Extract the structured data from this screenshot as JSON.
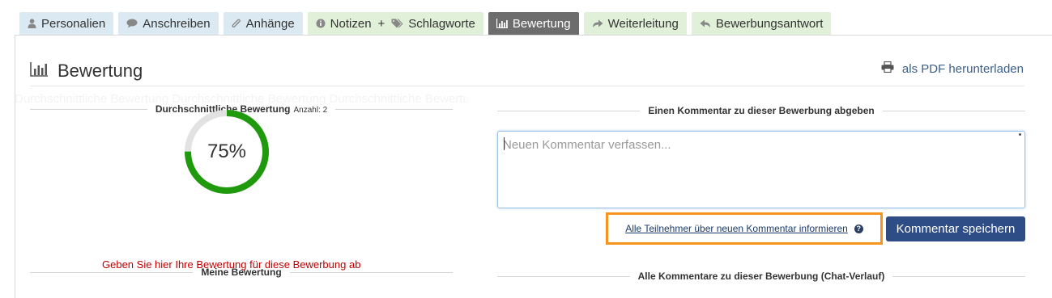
{
  "tabs": [
    {
      "label": "Personalien",
      "icon": "user-icon"
    },
    {
      "label": "Anschreiben",
      "icon": "speech-bubble-icon"
    },
    {
      "label": "Anhänge",
      "icon": "paperclip-icon"
    },
    {
      "label_a": "Notizen",
      "label_plus": "+",
      "label_b": "Schlagworte",
      "icon": "info-icon",
      "icon2": "tags-icon"
    },
    {
      "label": "Bewertung",
      "icon": "bar-chart-icon"
    },
    {
      "label": "Weiterleitung",
      "icon": "forward-arrow-icon"
    },
    {
      "label": "Bewerbungsantwort",
      "icon": "reply-arrow-icon"
    }
  ],
  "header": {
    "title": "Bewertung",
    "pdf_label": "als PDF herunterladen"
  },
  "rating": {
    "section_label": "Durchschnittliche Bewertung",
    "count_label": "Anzahl: 2",
    "percent": 75,
    "percent_text": "75%",
    "ghost_text": "Durchschnittliche Bewertung Durchschnittliche Bewertung Durchschnittliche Bewertung"
  },
  "my_rating": {
    "section_label": "Meine Bewertung",
    "hint": "Geben Sie hier Ihre Bewertung für diese Bewerbung ab"
  },
  "comment": {
    "section_label": "Einen Kommentar zu dieser Bewerbung abgeben",
    "placeholder": "Neuen Kommentar verfassen...",
    "notify_link": "Alle Teilnehmer über neuen Kommentar informieren",
    "save_label": "Kommentar speichern"
  },
  "all_comments": {
    "section_label": "Alle Kommentare zu dieser Bewerbung (Chat-Verlauf)"
  },
  "colors": {
    "tab_blue": "#dbeaf2",
    "tab_green": "#e1f0d9",
    "tab_active": "#6d6d6d",
    "donut_fill": "#1e9a0c",
    "donut_track": "#e2e2e2",
    "save_button": "#2e4c85",
    "highlight": "#f7941d",
    "hint_red": "#c00000"
  }
}
